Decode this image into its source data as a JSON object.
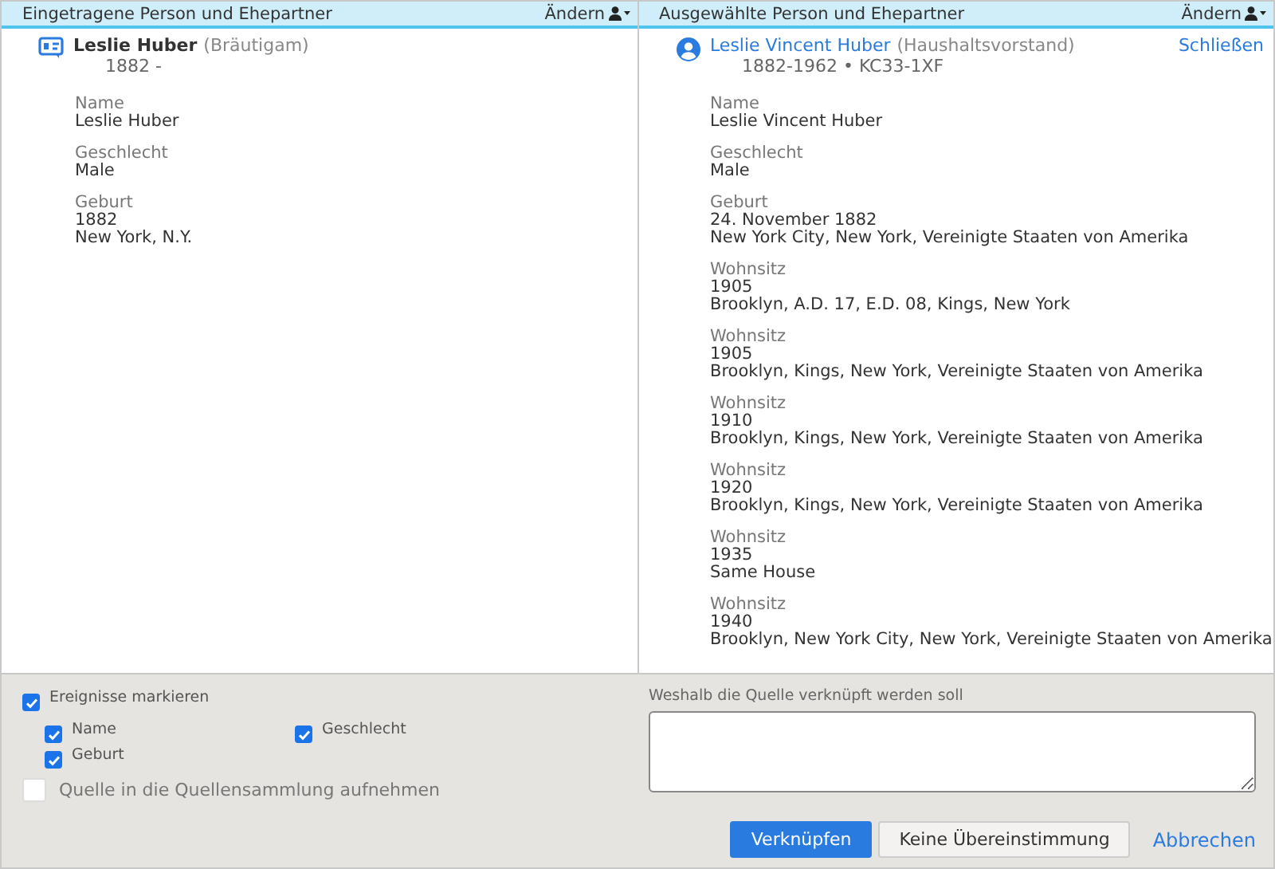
{
  "panels": [
    {
      "header": "Eingetragene Person und Ehepartner",
      "change": "Ändern",
      "person": {
        "kind": "record",
        "name": "Leslie Huber",
        "role": "(Bräutigam)",
        "dates": "1882 -"
      },
      "facts": [
        {
          "label": "Name",
          "lines": [
            "Leslie Huber"
          ]
        },
        {
          "label": "Geschlecht",
          "lines": [
            "Male"
          ]
        },
        {
          "label": "Geburt",
          "lines": [
            "1882",
            "New York, N.Y."
          ]
        }
      ]
    },
    {
      "header": "Ausgewählte Person und Ehepartner",
      "change": "Ändern",
      "close": "Schließen",
      "person": {
        "kind": "person",
        "name": "Leslie Vincent Huber",
        "role": "(Haushaltsvorstand)",
        "dates": "1882-1962 • KC33-1XF"
      },
      "facts": [
        {
          "label": "Name",
          "lines": [
            "Leslie Vincent Huber"
          ]
        },
        {
          "label": "Geschlecht",
          "lines": [
            "Male"
          ]
        },
        {
          "label": "Geburt",
          "lines": [
            "24. November 1882",
            "New York City, New York, Vereinigte Staaten von Amerika"
          ]
        },
        {
          "label": "Wohnsitz",
          "lines": [
            "1905",
            "Brooklyn, A.D. 17, E.D. 08, Kings, New York"
          ]
        },
        {
          "label": "Wohnsitz",
          "lines": [
            "1905",
            "Brooklyn, Kings, New York, Vereinigte Staaten von Amerika"
          ]
        },
        {
          "label": "Wohnsitz",
          "lines": [
            "1910",
            "Brooklyn, Kings, New York, Vereinigte Staaten von Amerika"
          ]
        },
        {
          "label": "Wohnsitz",
          "lines": [
            "1920",
            "Brooklyn, Kings, New York, Vereinigte Staaten von Amerika"
          ]
        },
        {
          "label": "Wohnsitz",
          "lines": [
            "1935",
            "Same House"
          ]
        },
        {
          "label": "Wohnsitz",
          "lines": [
            "1940",
            "Brooklyn, New York City, New York, Vereinigte Staaten von Amerika"
          ]
        }
      ]
    }
  ],
  "mark_events": {
    "label": "Ereignisse markieren",
    "checked": true,
    "items": [
      {
        "label": "Name",
        "checked": true
      },
      {
        "label": "Geschlecht",
        "checked": true
      },
      {
        "label": "Geburt",
        "checked": true
      }
    ]
  },
  "add_to_collection": {
    "label": "Quelle in die Quellensammlung aufnehmen",
    "checked": false
  },
  "reason": {
    "label": "Weshalb die Quelle verknüpft werden soll"
  },
  "buttons": [
    {
      "label": "Verknüpfen",
      "kind": "primary"
    },
    {
      "label": "Keine Übereinstimmung",
      "kind": "secondary"
    },
    {
      "label": "Abbrechen",
      "kind": "link"
    }
  ]
}
